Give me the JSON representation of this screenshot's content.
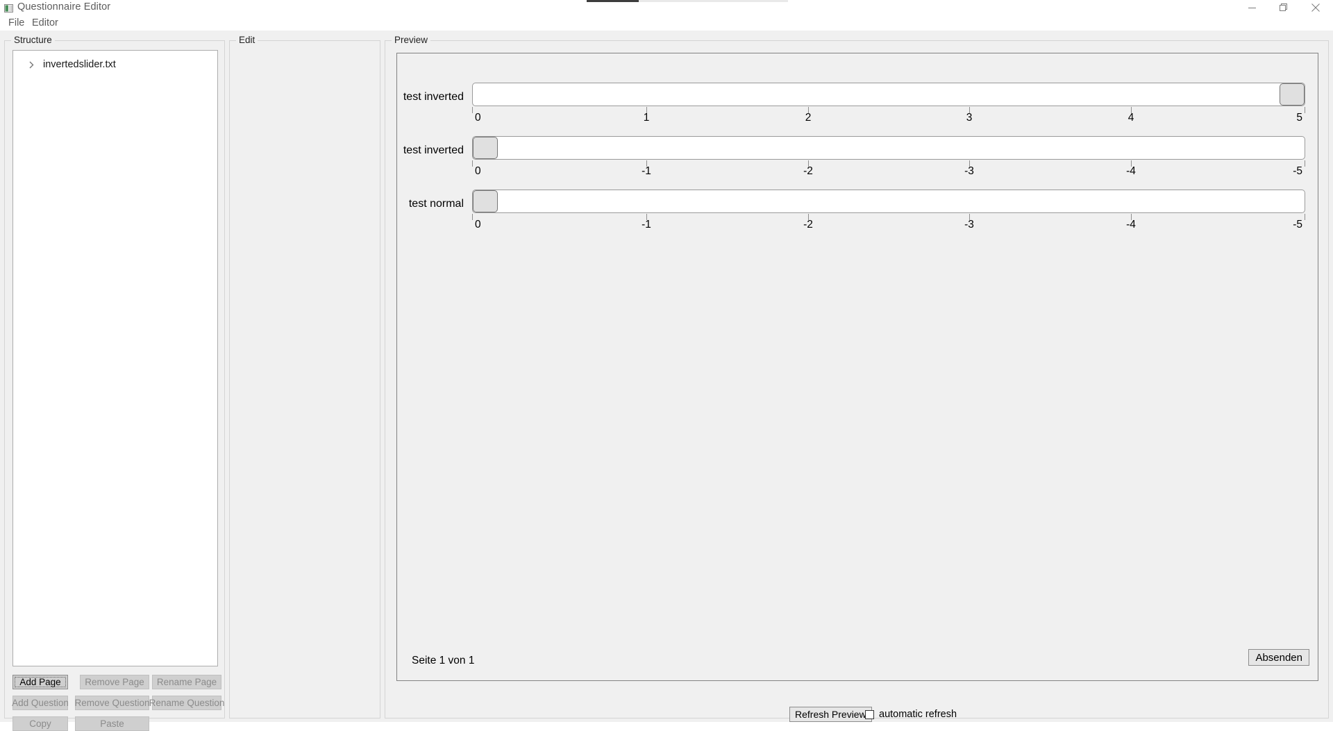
{
  "window": {
    "title": "Questionnaire Editor",
    "app_icon": "app-window-icon",
    "minimize_label": "—",
    "maximize_label": "❐",
    "close_label": "✕"
  },
  "menubar": {
    "items": [
      {
        "label": "File"
      },
      {
        "label": "Editor"
      }
    ]
  },
  "structure": {
    "title": "Structure",
    "tree": {
      "chevron": "chevron-right-icon",
      "items": [
        {
          "label": "invertedslider.txt"
        }
      ]
    },
    "buttons": [
      {
        "label": "Add Page",
        "enabled": true
      },
      {
        "label": "Remove Page",
        "enabled": false
      },
      {
        "label": "Rename Page",
        "enabled": false
      },
      {
        "label": "Add Question",
        "enabled": false
      },
      {
        "label": "Remove Question",
        "enabled": false
      },
      {
        "label": "Rename Question",
        "enabled": false
      },
      {
        "label": "Copy",
        "enabled": false
      },
      {
        "label": "Paste",
        "enabled": false
      }
    ]
  },
  "edit": {
    "title": "Edit"
  },
  "preview": {
    "title": "Preview",
    "page_indicator": "Seite 1 von 1",
    "submit_label": "Absenden",
    "sliders": [
      {
        "label": "test inverted",
        "inverted": true,
        "tick_labels": [
          "0",
          "1",
          "2",
          "3",
          "4",
          "5"
        ],
        "value": 5,
        "min": 0,
        "max": 5,
        "thumb_position_pct": 100
      },
      {
        "label": "test inverted",
        "inverted": true,
        "tick_labels": [
          "0",
          "-1",
          "-2",
          "-3",
          "-4",
          "-5"
        ],
        "value": 0,
        "min": 0,
        "max": -5,
        "thumb_position_pct": 0
      },
      {
        "label": "test normal",
        "inverted": false,
        "tick_labels": [
          "0",
          "-1",
          "-2",
          "-3",
          "-4",
          "-5"
        ],
        "value": 0,
        "min": 0,
        "max": -5,
        "thumb_position_pct": 0
      }
    ]
  },
  "refresh_bar": {
    "refresh_label": "Refresh Preview",
    "auto_refresh_label": "automatic refresh",
    "auto_refresh_checked": false
  },
  "colors": {
    "window_bg": "#ffffff",
    "panel_bg": "#f0f0f0",
    "button_bg": "#cfcfcf",
    "border": "#d4d4d4",
    "track_bg": "#ffffff",
    "thumb_bg": "#e0e0e0",
    "text": "#000000",
    "text_muted": "#8b8b8b",
    "title_text": "#5c5c5c"
  }
}
